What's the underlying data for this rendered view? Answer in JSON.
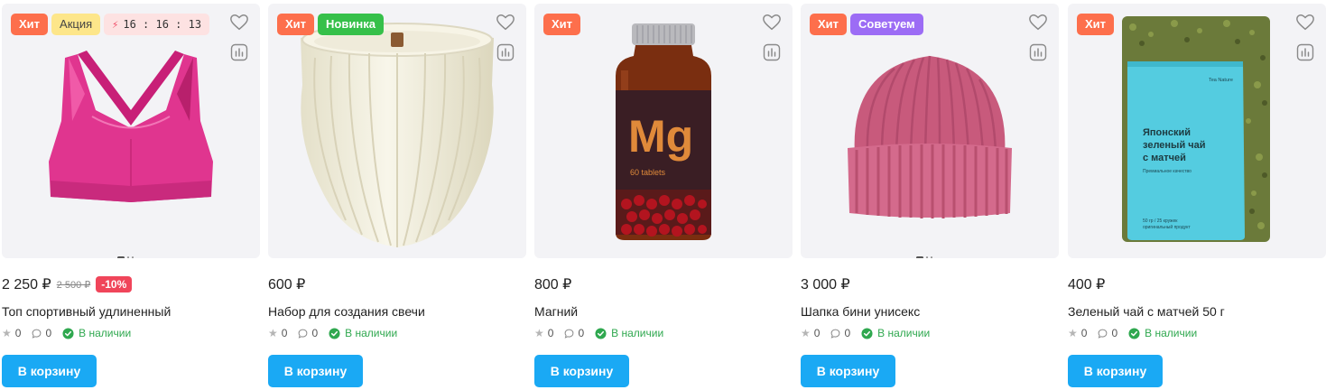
{
  "products": [
    {
      "badges": [
        "Хит",
        "Акция"
      ],
      "timer": "16 : 16 : 13",
      "price": "2 250 ₽",
      "old_price": "2 500 ₽",
      "discount": "-10%",
      "title": "Топ спортивный удлиненный",
      "rating": "0",
      "reviews": "0",
      "stock": "В наличии",
      "button": "В корзину"
    },
    {
      "badges": [
        "Хит",
        "Новинка"
      ],
      "price": "600 ₽",
      "title": "Набор для создания свечи",
      "rating": "0",
      "reviews": "0",
      "stock": "В наличии",
      "button": "В корзину"
    },
    {
      "badges": [
        "Хит"
      ],
      "price": "800 ₽",
      "title": "Магний",
      "rating": "0",
      "reviews": "0",
      "stock": "В наличии",
      "button": "В корзину",
      "image_text": {
        "big": "Mg",
        "small": "60 tablets"
      }
    },
    {
      "badges": [
        "Хит",
        "Советуем"
      ],
      "price": "3 000 ₽",
      "title": "Шапка бини унисекс",
      "rating": "0",
      "reviews": "0",
      "stock": "В наличии",
      "button": "В корзину"
    },
    {
      "badges": [
        "Хит"
      ],
      "price": "400 ₽",
      "title": "Зеленый чай с матчей 50 г",
      "rating": "0",
      "reviews": "0",
      "stock": "В наличии",
      "button": "В корзину",
      "image_text": {
        "brand": "Tea Nature",
        "line1": "Японский",
        "line2": "зеленый чай",
        "line3": "с матчей",
        "sub": "Премиальное качество",
        "foot1": "50 гр / 25 кружек",
        "foot2": "оригинальный продукт"
      }
    }
  ],
  "colors": {
    "hit": "#fd6f4c",
    "sale": "#fde68a",
    "new": "#36c04a",
    "advise": "#9c6cf5",
    "discount": "#f0455a",
    "button": "#1aa9f4",
    "in_stock": "#2fa84f"
  },
  "icons": {
    "favorite": "heart-icon",
    "compare": "compare-chart-icon",
    "rating": "star-icon",
    "reviews": "comment-icon",
    "stock": "check-circle-icon",
    "timer": "lightning-icon"
  }
}
